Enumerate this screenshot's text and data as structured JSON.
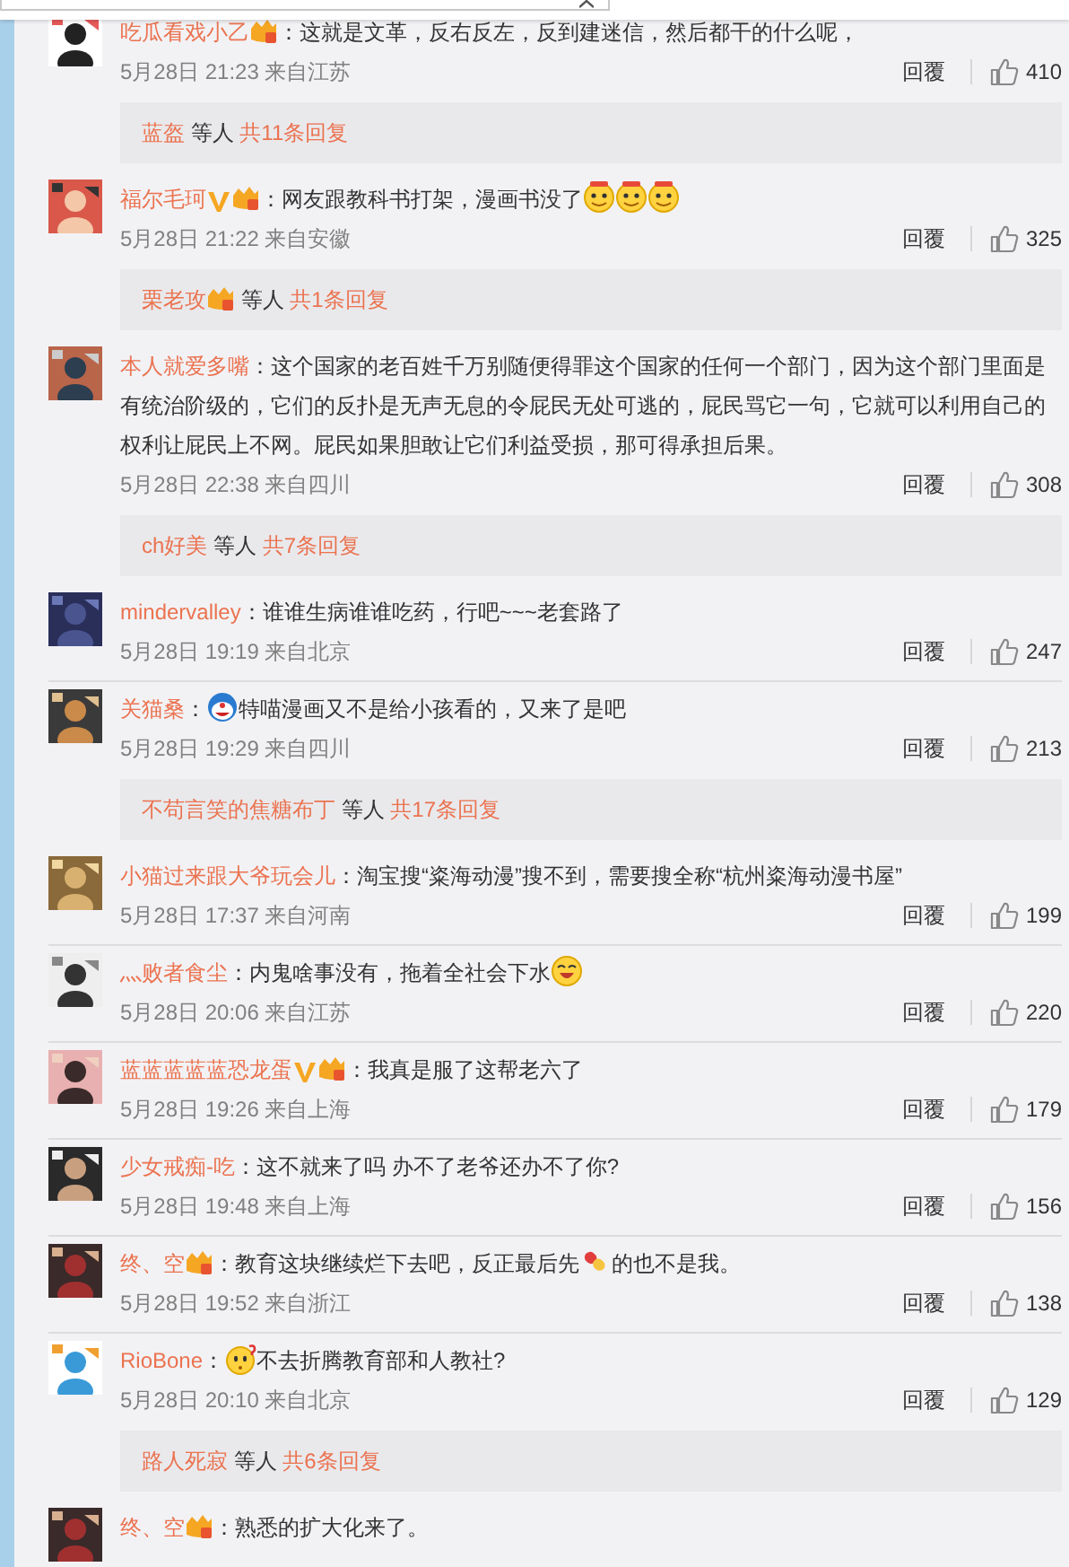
{
  "comments": [
    {
      "name": "吃瓜看戏小乙",
      "verified": false,
      "vip": true,
      "colon": "：",
      "content": [
        {
          "kind": "text",
          "text": "这就是文革，反右反左，反到建迷信，然后都干的什么呢，"
        }
      ],
      "date": "5月28日 21:23 来自江苏",
      "reply": "回覆",
      "likes": "410",
      "thread": {
        "name": "蓝盔",
        "vip": false,
        "sep": "等人",
        "total": "共11条回复"
      }
    },
    {
      "name": "福尔毛珂",
      "verified": true,
      "vip": true,
      "colon": "：",
      "content": [
        {
          "kind": "text",
          "text": "网友跟教科书打架，漫画书没了"
        },
        {
          "kind": "smiley"
        },
        {
          "kind": "smiley"
        },
        {
          "kind": "smiley"
        }
      ],
      "date": "5月28日 21:22 来自安徽",
      "reply": "回覆",
      "likes": "325",
      "thread": {
        "name": "栗老攻",
        "vip": true,
        "sep": "等人",
        "total": "共1条回复"
      }
    },
    {
      "name": "本人就爱多嘴",
      "verified": false,
      "vip": false,
      "colon": "：",
      "content": [
        {
          "kind": "text",
          "text": "这个国家的老百姓千万别随便得罪这个国家的任何一个部门，因为这个部门里面是有统治阶级的，它们的反扑是无声无息的令屁民无处可逃的，屁民骂它一句，它就可以利用自己的权利让屁民上不网。屁民如果胆敢让它们利益受损，那可得承担后果。"
        }
      ],
      "date": "5月28日 22:38 来自四川",
      "reply": "回覆",
      "likes": "308",
      "thread": {
        "name": "ch好美",
        "vip": false,
        "sep": "等人",
        "total": "共7条回复"
      }
    },
    {
      "name": "mindervalley",
      "verified": false,
      "vip": false,
      "colon": "：",
      "content": [
        {
          "kind": "text",
          "text": "谁谁生病谁谁吃药，行吧~~~老套路了"
        }
      ],
      "date": "5月28日 19:19 来自北京",
      "reply": "回覆",
      "likes": "247"
    },
    {
      "name": "关猫桑",
      "verified": false,
      "vip": false,
      "colon": "：",
      "content": [
        {
          "kind": "blue-face"
        },
        {
          "kind": "text",
          "text": "特喵漫画又不是给小孩看的，又来了是吧"
        }
      ],
      "date": "5月28日 19:29 来自四川",
      "reply": "回覆",
      "likes": "213",
      "thread": {
        "name": "不苟言笑的焦糖布丁",
        "vip": false,
        "sep": "等人",
        "total": "共17条回复"
      }
    },
    {
      "name": "小猫过来跟大爷玩会儿",
      "verified": false,
      "vip": false,
      "colon": "：",
      "content": [
        {
          "kind": "text",
          "text": "淘宝搜“粢海动漫”搜不到，需要搜全称“杭州粢海动漫书屋”"
        }
      ],
      "date": "5月28日 17:37 来自河南",
      "reply": "回覆",
      "likes": "199"
    },
    {
      "name": "灬败者食尘",
      "verified": false,
      "vip": false,
      "colon": "：",
      "content": [
        {
          "kind": "text",
          "text": "内鬼啥事没有，拖着全社会下水"
        },
        {
          "kind": "grin"
        }
      ],
      "date": "5月28日 20:06 来自江苏",
      "reply": "回覆",
      "likes": "220"
    },
    {
      "name": "蓝蓝蓝蓝蓝恐龙蛋",
      "verified": true,
      "vip": true,
      "colon": "：",
      "content": [
        {
          "kind": "text",
          "text": "我真是服了这帮老六了"
        }
      ],
      "date": "5月28日 19:26 来自上海",
      "reply": "回覆",
      "likes": "179"
    },
    {
      "name": "少女戒痴-吃",
      "verified": false,
      "vip": false,
      "colon": "：",
      "content": [
        {
          "kind": "text",
          "text": "这不就来了吗 办不了老爷还办不了你?"
        }
      ],
      "date": "5月28日 19:48 来自上海",
      "reply": "回覆",
      "likes": "156"
    },
    {
      "name": "终、空",
      "verified": false,
      "vip": true,
      "colon": "：",
      "content": [
        {
          "kind": "text",
          "text": "教育这块继续烂下去吧，反正最后先"
        },
        {
          "kind": "pill"
        },
        {
          "kind": "text",
          "text": "的也不是我。"
        }
      ],
      "date": "5月28日 19:52 来自浙江",
      "reply": "回覆",
      "likes": "138"
    },
    {
      "name": "RioBone",
      "verified": false,
      "vip": false,
      "colon": "：",
      "content": [
        {
          "kind": "puzzled"
        },
        {
          "kind": "text",
          "text": "不去折腾教育部和人教社?"
        }
      ],
      "date": "5月28日 20:10 来自北京",
      "reply": "回覆",
      "likes": "129",
      "thread": {
        "name": "路人死寂",
        "vip": false,
        "sep": "等人",
        "total": "共6条回复"
      }
    },
    {
      "name": "终、空",
      "verified": false,
      "vip": true,
      "colon": "：",
      "content": [
        {
          "kind": "text",
          "text": "熟悉的扩大化来了。"
        }
      ]
    }
  ]
}
